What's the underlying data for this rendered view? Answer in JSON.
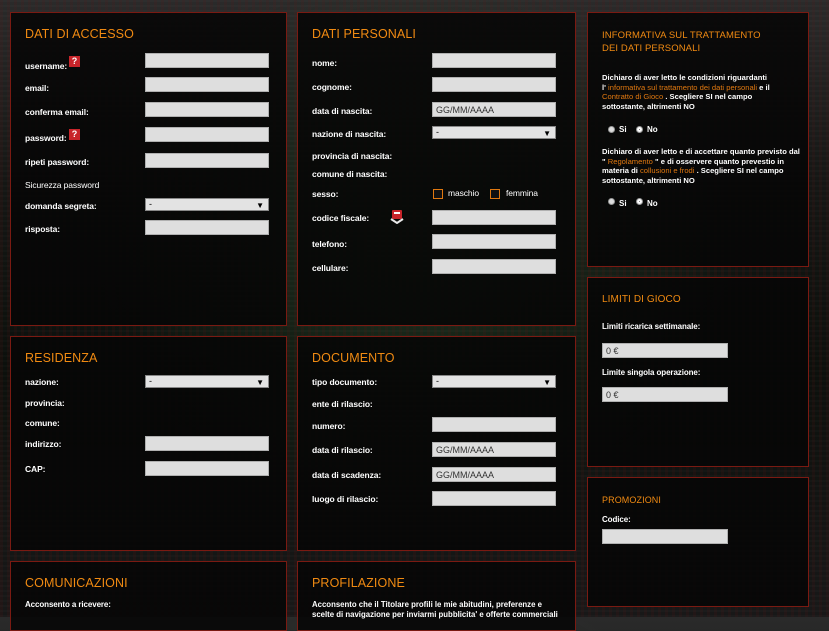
{
  "accesso": {
    "title": "DATI DI ACCESSO",
    "username": "username:",
    "email": "email:",
    "conferma_email": "conferma email:",
    "password": "password:",
    "ripeti_password": "ripeti password:",
    "sicurezza": "Sicurezza password",
    "domanda": "domanda segreta:",
    "domanda_value": "-",
    "risposta": "risposta:",
    "help_icon": "?"
  },
  "personali": {
    "title": "DATI PERSONALI",
    "nome": "nome:",
    "cognome": "cognome:",
    "data_nascita": "data di nascita:",
    "data_nascita_value": "GG/MM/AAAA",
    "nazione_nascita": "nazione di nascita:",
    "nazione_nascita_value": "-",
    "provincia_nascita": "provincia di nascita:",
    "comune_nascita": "comune di nascita:",
    "sesso": "sesso:",
    "maschio": "maschio",
    "femmina": "femmina",
    "codice_fiscale": "codice fiscale:",
    "telefono": "telefono:",
    "cellulare": "cellulare:"
  },
  "informativa": {
    "title1": "INFORMATIVA SUL TRATTAMENTO",
    "title2": "DEI DATI PERSONALI",
    "p1_a": "Dichiaro di aver letto le condizioni riguardanti",
    "p1_b": "l'",
    "p1_link1": "informativa sul trattamento dei dati personali",
    "p1_c": "e il",
    "p1_link2": "Contratto di Gioco",
    "p1_d": ". Scegliere SI nel campo",
    "p1_e": "sottostante, altrimenti NO",
    "si": "Si",
    "no": "No",
    "p2_a": "Dichiaro di aver letto e di accettare quanto previsto dal",
    "p2_b": "\"",
    "p2_link1": "Regolamento",
    "p2_c": "\" e di osservere quanto prevestio in",
    "p2_d": "materia di",
    "p2_link2": "collusioni e frodi",
    "p2_e": ". Scegliere SI nel campo",
    "p2_f": "sottostante, altrimenti NO"
  },
  "limiti": {
    "title": "LIMITI DI GIOCO",
    "settimanale": "Limiti ricarica settimanale:",
    "settimanale_value": "0 €",
    "singola": "Limite singola operazione:",
    "singola_value": "0 €"
  },
  "residenza": {
    "title": "RESIDENZA",
    "nazione": "nazione:",
    "nazione_value": "-",
    "provincia": "provincia:",
    "comune": "comune:",
    "indirizzo": "indirizzo:",
    "cap": "CAP:"
  },
  "documento": {
    "title": "DOCUMENTO",
    "tipo": "tipo documento:",
    "tipo_value": "-",
    "ente": "ente di rilascio:",
    "numero": "numero:",
    "data_rilascio": "data di rilascio:",
    "data_rilascio_value": "GG/MM/AAAA",
    "data_scadenza": "data di scadenza:",
    "data_scadenza_value": "GG/MM/AAAA",
    "luogo": "luogo di rilascio:"
  },
  "promozioni": {
    "title": "PROMOZIONI",
    "codice": "Codice:"
  },
  "comunicazioni": {
    "title": "COMUNICAZIONI",
    "text": "Acconsento a ricevere:"
  },
  "profilazione": {
    "title": "PROFILAZIONE",
    "line1": "Acconsento che il Titolare profili le mie abitudini, preferenze e",
    "line2": "scelte di navigazione per inviarmi pubblicita' e offerte commerciali"
  },
  "colors": {
    "accent": "#f08a12",
    "border": "#7a1a12",
    "help": "#c8242a"
  }
}
